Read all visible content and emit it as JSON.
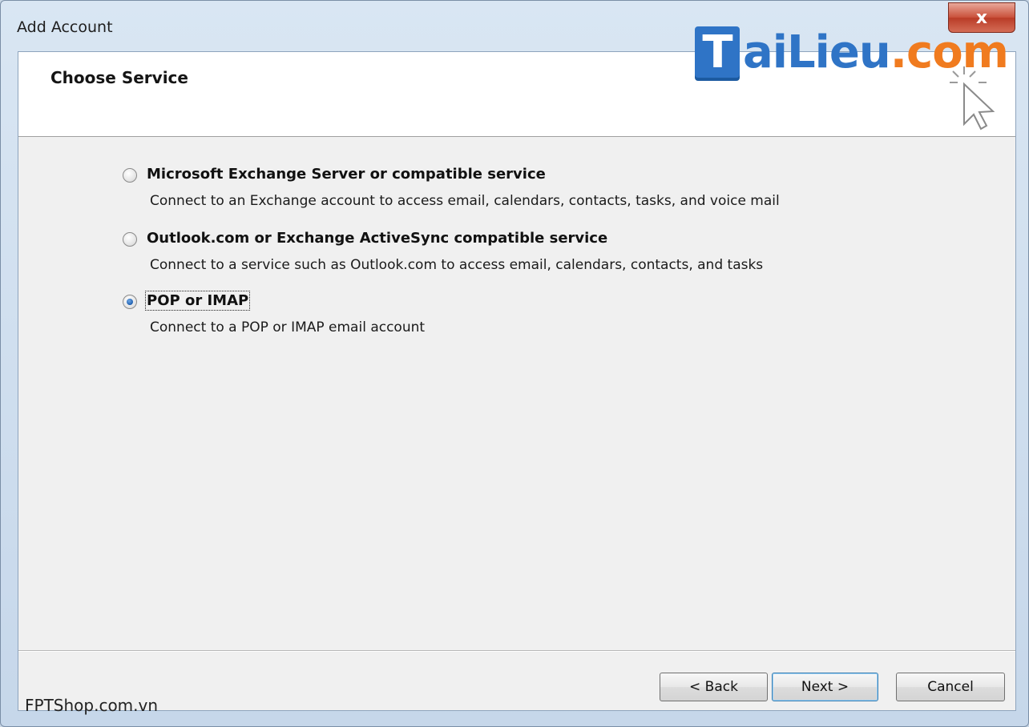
{
  "window": {
    "title": "Add Account",
    "close_glyph": "x",
    "close_icon": "close-icon"
  },
  "header": {
    "title": "Choose Service"
  },
  "watermark": {
    "logo_letter": "T",
    "logo_blue": "aiLieu",
    "logo_orange": ".com",
    "cursor_icon": "mouse-pointer-icon"
  },
  "options": [
    {
      "label": "Microsoft Exchange Server or compatible service",
      "description": "Connect to an Exchange account to access email, calendars, contacts, tasks, and voice mail",
      "checked": false
    },
    {
      "label": "Outlook.com or Exchange ActiveSync compatible service",
      "description": "Connect to a service such as Outlook.com to access email, calendars, contacts, and tasks",
      "checked": false
    },
    {
      "label": "POP or IMAP",
      "description": "Connect to a POP or IMAP email account",
      "checked": true
    }
  ],
  "buttons": {
    "back": "< Back",
    "next": "Next >",
    "cancel": "Cancel"
  },
  "footer": {
    "source": "FPTShop.com.vn"
  }
}
